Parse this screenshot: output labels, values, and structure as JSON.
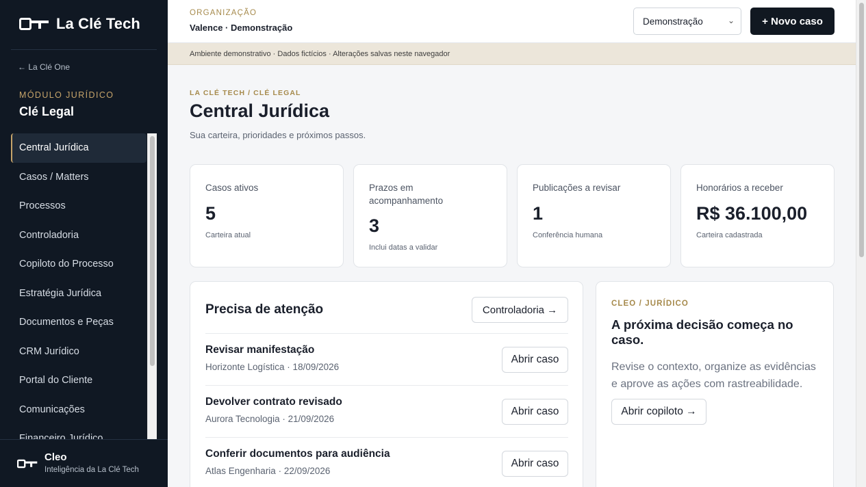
{
  "sidebar": {
    "brand": "La Clé Tech",
    "back_link": "← La Clé One",
    "module_caption": "MÓDULO JURÍDICO",
    "module_title": "Clé Legal",
    "items": [
      {
        "label": "Central Jurídica",
        "active": true
      },
      {
        "label": "Casos / Matters"
      },
      {
        "label": "Processos"
      },
      {
        "label": "Controladoria"
      },
      {
        "label": "Copiloto do Processo"
      },
      {
        "label": "Estratégia Jurídica"
      },
      {
        "label": "Documentos e Peças"
      },
      {
        "label": "CRM Jurídico"
      },
      {
        "label": "Portal do Cliente"
      },
      {
        "label": "Comunicações"
      },
      {
        "label": "Financeiro Jurídico"
      }
    ],
    "cleo": {
      "name": "Cleo",
      "subtitle": "Inteligência da La Clé Tech"
    }
  },
  "topbar": {
    "org_caption": "ORGANIZAÇÃO",
    "org_name": "Valence · Demonstração",
    "select_value": "Demonstração",
    "new_case_label": "+ Novo caso"
  },
  "banner": "Ambiente demonstrativo · Dados fictícios · Alterações salvas neste navegador",
  "page": {
    "crumb": "LA CLÉ TECH / CLÉ LEGAL",
    "title": "Central Jurídica",
    "subtitle": "Sua carteira, prioridades e próximos passos."
  },
  "stats": [
    {
      "label": "Casos ativos",
      "value": "5",
      "note": "Carteira atual"
    },
    {
      "label": "Prazos em acompanhamento",
      "value": "3",
      "note": "Inclui datas a validar"
    },
    {
      "label": "Publicações a revisar",
      "value": "1",
      "note": "Conferência humana"
    },
    {
      "label": "Honorários a receber",
      "value": "R$ 36.100,00",
      "note": "Carteira cadastrada"
    }
  ],
  "attention": {
    "title": "Precisa de atenção",
    "controladoria_label": "Controladoria →",
    "open_label": "Abrir caso",
    "rows": [
      {
        "title": "Revisar manifestação",
        "meta": "Horizonte Logística · 18/09/2026"
      },
      {
        "title": "Devolver contrato revisado",
        "meta": "Aurora Tecnologia · 21/09/2026"
      },
      {
        "title": "Conferir documentos para audiência",
        "meta": "Atlas Engenharia · 22/09/2026"
      }
    ]
  },
  "cleo_card": {
    "caption": "CLEO / JURÍDICO",
    "title": "A próxima decisão começa no caso.",
    "text": "Revise o contexto, organize as evidências e aprove as ações com rastreabilidade.",
    "button": "Abrir copiloto →"
  }
}
